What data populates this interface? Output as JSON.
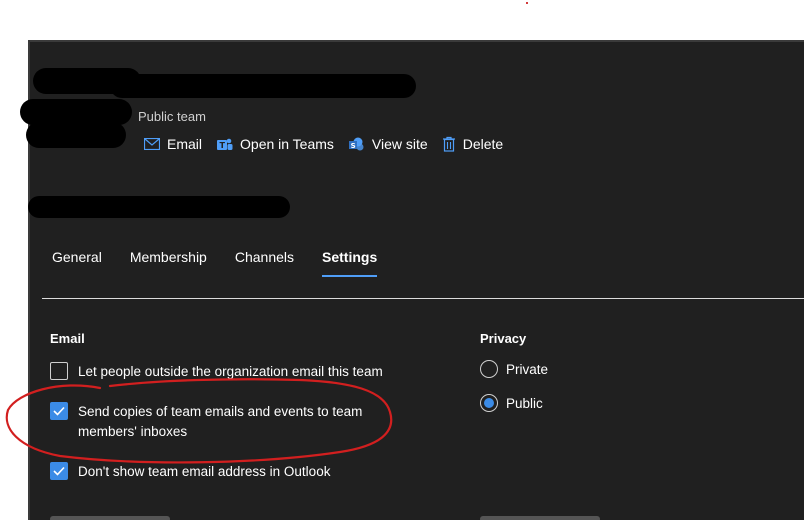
{
  "header": {
    "team_type": "Public team",
    "actions": [
      {
        "label": "Email",
        "icon": "mail-icon"
      },
      {
        "label": "Open in Teams",
        "icon": "teams-icon"
      },
      {
        "label": "View site",
        "icon": "sharepoint-icon"
      },
      {
        "label": "Delete",
        "icon": "trash-icon"
      }
    ]
  },
  "tabs": [
    {
      "label": "General",
      "active": false
    },
    {
      "label": "Membership",
      "active": false
    },
    {
      "label": "Channels",
      "active": false
    },
    {
      "label": "Settings",
      "active": true
    }
  ],
  "email": {
    "title": "Email",
    "options": [
      {
        "label": "Let people outside the organization email this team",
        "checked": false
      },
      {
        "label": "Send copies of team emails and events to team members' inboxes",
        "checked": true
      },
      {
        "label": "Don't show team email address in Outlook",
        "checked": true
      }
    ]
  },
  "privacy": {
    "title": "Privacy",
    "options": [
      {
        "label": "Private",
        "selected": false
      },
      {
        "label": "Public",
        "selected": true
      }
    ]
  },
  "colors": {
    "background": "#202020",
    "accent": "#3b8be6",
    "link_icon": "#4f9ef8",
    "annotation": "#d21f1f"
  }
}
